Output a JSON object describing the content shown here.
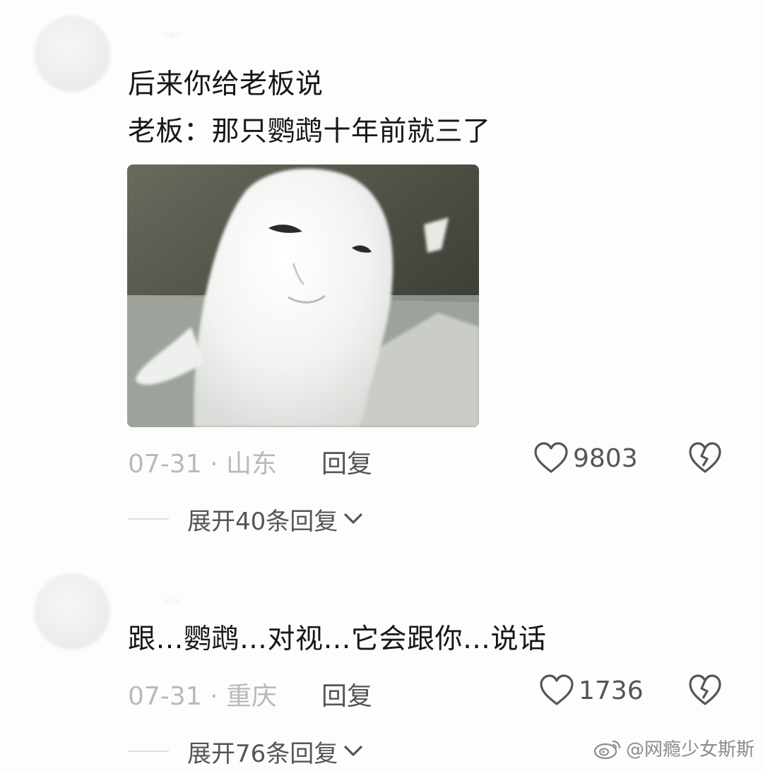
{
  "comments": [
    {
      "username": "…",
      "lines": [
        "后来你给老板说",
        "老板：那只鹦鹉十年前就三了"
      ],
      "has_image": true,
      "date_location": "07-31 · 山东",
      "reply_label": "回复",
      "likes": "9803",
      "expand_label": "展开40条回复"
    },
    {
      "username": "…",
      "lines": [
        "跟…鹦鹉…对视…它会跟你…说话"
      ],
      "has_image": false,
      "date_location": "07-31 · 重庆",
      "reply_label": "回复",
      "likes": "1736",
      "expand_label": "展开76条回复"
    }
  ],
  "icons": {
    "like": "heart-outline-icon",
    "dislike": "broken-heart-icon",
    "expand": "chevron-down-icon",
    "watermark": "weibo-logo-icon"
  },
  "watermark": "@网瘾少女斯斯",
  "colors": {
    "background": "#fdfdfc",
    "text": "#171717",
    "meta": "#b9b9b9",
    "action": "#555555"
  }
}
